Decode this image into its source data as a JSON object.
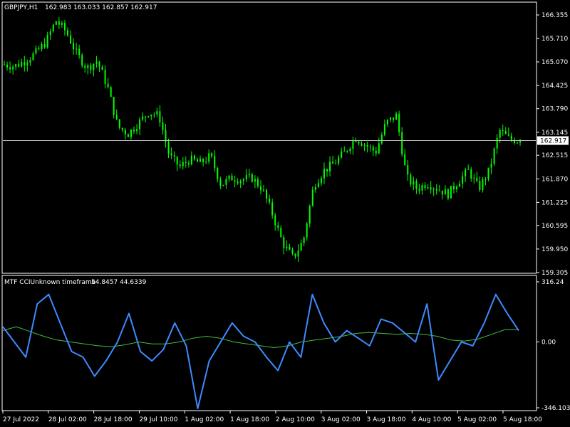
{
  "header": {
    "symbol_label": "GBPJPY,H1",
    "ohlc": "162.983 163.033 162.857 162.917"
  },
  "indicator": {
    "label": "MTF CCIUnknown timeframe",
    "values": "54.8457 44.6339"
  },
  "colors": {
    "background": "#000000",
    "candle": "#00ff00",
    "cci": "#3d8bff",
    "signal": "#40c040",
    "grid": "#ffffff",
    "price_line": "#c0c0c0"
  },
  "chart_data": [
    {
      "type": "candlestick",
      "symbol": "GBPJPY",
      "timeframe": "H1",
      "current_price": 162.917,
      "current_price_label": "162.917",
      "ylim": [
        159.305,
        166.355
      ],
      "y_ticks": [
        "166.355",
        "165.710",
        "165.070",
        "164.425",
        "163.790",
        "163.145",
        "162.515",
        "161.870",
        "161.225",
        "160.595",
        "159.950",
        "159.305"
      ],
      "price_path": [
        165.0,
        164.95,
        165.1,
        165.3,
        165.6,
        166.2,
        165.9,
        165.3,
        164.9,
        165.1,
        164.4,
        163.3,
        163.1,
        163.4,
        163.7,
        163.6,
        162.5,
        162.2,
        162.4,
        162.3,
        162.5,
        161.7,
        161.9,
        161.85,
        161.9,
        161.6,
        160.9,
        160.1,
        159.7,
        160.2,
        161.7,
        162.1,
        162.3,
        162.6,
        163.0,
        162.8,
        162.6,
        163.4,
        163.6,
        161.9,
        161.6,
        161.75,
        161.6,
        161.45,
        161.8,
        162.1,
        161.6,
        162.1,
        163.2,
        162.95,
        162.917
      ]
    },
    {
      "type": "line",
      "name": "MTF CCI",
      "ylim": [
        -346.1036,
        316.24
      ],
      "y_ticks": [
        "316.24",
        "0.00",
        "-346.1036"
      ],
      "x_ticks": [
        "27 Jul 2022",
        "28 Jul 02:00",
        "28 Jul 18:00",
        "29 Jul 10:00",
        "1 Aug 02:00",
        "1 Aug 18:00",
        "2 Aug 10:00",
        "3 Aug 02:00",
        "3 Aug 18:00",
        "4 Aug 10:00",
        "5 Aug 02:00",
        "5 Aug 18:00"
      ],
      "cci": [
        80,
        0,
        -80,
        200,
        250,
        100,
        -50,
        -80,
        -180,
        -100,
        0,
        150,
        -50,
        -100,
        -40,
        100,
        -20,
        -350,
        -100,
        0,
        100,
        30,
        0,
        -80,
        -150,
        0,
        -80,
        250,
        100,
        0,
        60,
        20,
        -20,
        120,
        100,
        50,
        0,
        200,
        -200,
        -100,
        0,
        -20,
        100,
        250,
        150,
        60
      ],
      "signal": [
        60,
        80,
        55,
        30,
        10,
        0,
        -10,
        -20,
        -25,
        -15,
        0,
        -10,
        -10,
        0,
        20,
        30,
        20,
        0,
        -10,
        -20,
        -30,
        -20,
        0,
        10,
        20,
        30,
        45,
        50,
        45,
        40,
        45,
        40,
        30,
        10,
        5,
        15,
        40,
        65,
        65
      ]
    }
  ]
}
